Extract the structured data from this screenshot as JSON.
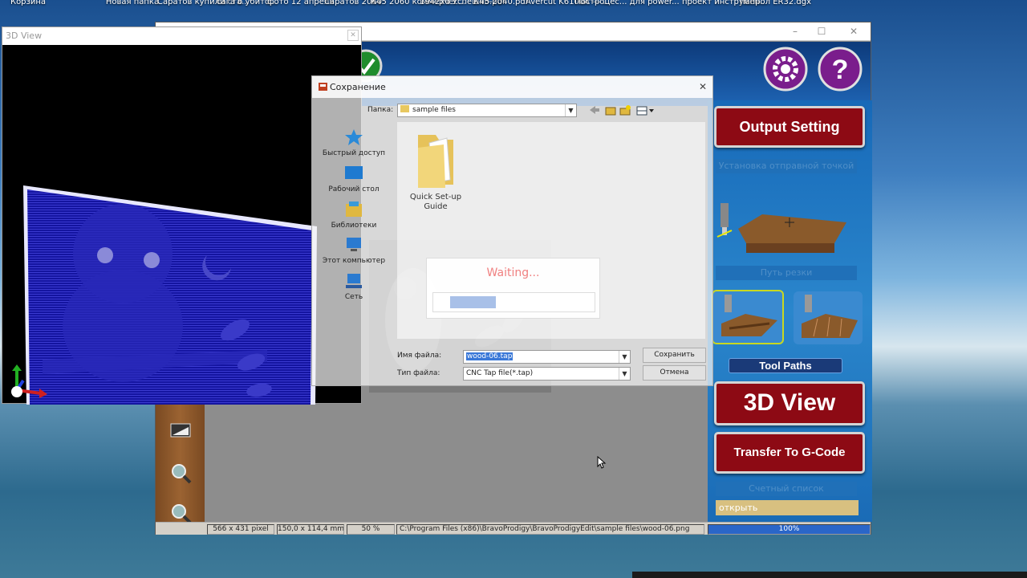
{
  "desktop": {
    "items": [
      {
        "label": "Корзина"
      },
      {
        "label": "Новая папка"
      },
      {
        "label": "Саратов купили ста..."
      },
      {
        "label": "сага о убито..."
      },
      {
        "label": "фото 12 апреля"
      },
      {
        "label": "Саратов 2060"
      },
      {
        "label": "К45 2060 коммерчес..."
      },
      {
        "label": "1942xd Успешно.pdf"
      },
      {
        "label": "К45-2040.pdf"
      },
      {
        "label": "Avercut K6100A — ..."
      },
      {
        "label": "Построцес... для power..."
      },
      {
        "label": "проект инструмен..."
      },
      {
        "label": "папрол ER32.dgx"
      }
    ]
  },
  "view3d": {
    "title": "3D View"
  },
  "save_dialog": {
    "title": "Сохранение",
    "folder_label": "Папка:",
    "folder_value": "sample files",
    "nav": {
      "quick_access": "Быстрый доступ",
      "desktop": "Рабочий стол",
      "libraries": "Библиотеки",
      "this_pc": "Этот компьютер",
      "network": "Сеть"
    },
    "file_item": "Quick Set-up Guide",
    "filename_label": "Имя файла:",
    "filename_value": "wood-06.tap",
    "filetype_label": "Тип файла:",
    "filetype_value": "CNC Tap file(*.tap)",
    "save_button": "Сохранить",
    "cancel_button": "Отмена"
  },
  "waiting": {
    "text": "Waiting...",
    "progress": 0.3
  },
  "right_panel": {
    "output_setting": "Output Setting",
    "origin_label": "Установка отправной точкой",
    "cut_path_label": "Путь резки",
    "tool_paths": "Tool Paths",
    "view_3d": "3D View",
    "transfer": "Transfer To G-Code",
    "count_label": "Счетный список",
    "open_label": "открыть"
  },
  "status_bar": {
    "pixels": "566 x 431 pixel",
    "size": "150,0 x 114,4 mm",
    "zoom": "50 %",
    "path": "C:\\Program Files (x86)\\BravoProdigy\\BravoProdigyEdit\\sample files\\wood-06.png",
    "progress": "100%",
    "progress_value": 1.0
  },
  "colors": {
    "accent_red": "#8d0a14",
    "panel_blue": "#1e72bd",
    "header_blue": "#0d3a7a",
    "toolbar_brown": "#8a5428"
  }
}
